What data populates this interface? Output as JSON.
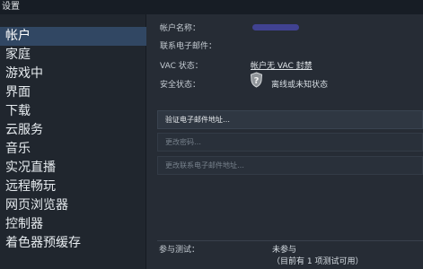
{
  "window": {
    "title": "设置"
  },
  "sidebar": {
    "items": [
      {
        "label": "帐户",
        "selected": true
      },
      {
        "label": "家庭"
      },
      {
        "label": "游戏中"
      },
      {
        "label": "界面"
      },
      {
        "label": "下载"
      },
      {
        "label": "云服务"
      },
      {
        "label": "音乐"
      },
      {
        "label": "实况直播"
      },
      {
        "label": "远程畅玩"
      },
      {
        "label": "网页浏览器"
      },
      {
        "label": "控制器"
      },
      {
        "label": "着色器预缓存"
      }
    ]
  },
  "account": {
    "name_label": "帐户名称：",
    "email_label": "联系电子邮件：",
    "vac_label": "VAC 状态：",
    "vac_value": "帐户无 VAC 封禁",
    "security_label": "安全状态：",
    "security_value": "离线或未知状态",
    "security_icon": "steam-guard-unknown-icon"
  },
  "actions": {
    "verify_email": "验证电子邮件地址…",
    "change_password": "更改密码…",
    "change_email": "更改联系电子邮件地址…"
  },
  "beta": {
    "label": "参与测试：",
    "value": "未参与",
    "note": "（目前有 1 项测试可用）"
  },
  "colors": {
    "selected_bg": "#314763",
    "sidebar_bg": "#20262e",
    "content_bg": "#262c35"
  }
}
